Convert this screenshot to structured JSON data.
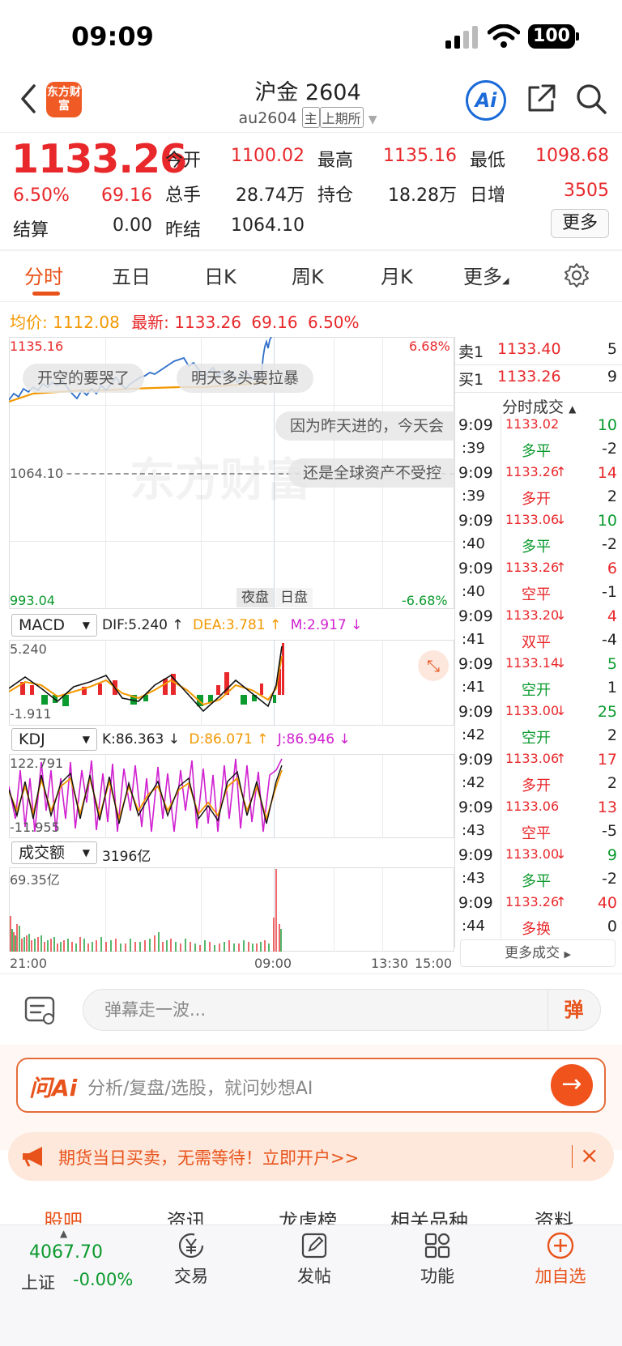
{
  "status_bar": {
    "time": "09:09",
    "battery": "100"
  },
  "header": {
    "title": "沪金 2604",
    "code": "au2604",
    "tag_main": "主",
    "tag_exchange": "上期所",
    "logo_text": "东方财富",
    "ai_label": "Ai"
  },
  "quote": {
    "price": "1133.26",
    "change_pct": "6.50%",
    "change": "69.16",
    "open_label": "今开",
    "open": "1100.02",
    "high_label": "最高",
    "high": "1135.16",
    "low_label": "最低",
    "low": "1098.68",
    "volume_label": "总手",
    "volume": "28.74万",
    "oi_label": "持仓",
    "oi": "18.28万",
    "daily_inc_label": "日增",
    "daily_inc": "3505",
    "settle_label": "结算",
    "settle": "0.00",
    "prev_settle_label": "昨结",
    "prev_settle": "1064.10",
    "more_label": "更多"
  },
  "tabs": [
    "分时",
    "五日",
    "日K",
    "周K",
    "月K",
    "更多"
  ],
  "avg_bar": {
    "avg_label": "均价:",
    "avg": "1112.08",
    "latest_label": "最新:",
    "latest": "1133.26",
    "chg": "69.16",
    "pct": "6.50%"
  },
  "main_chart": {
    "top_price": "1135.16",
    "mid_price": "1064.10",
    "bottom_price": "993.04",
    "top_pct": "6.68%",
    "bottom_pct": "-6.68%",
    "night_btn": "夜盘",
    "day_btn": "日盘",
    "watermark": "东方财富",
    "danmu": [
      "开空的要哭了",
      "明天多头要拉暴",
      "因为昨天进的，今天会",
      "还是全球资产不受控"
    ]
  },
  "macd": {
    "select": "MACD",
    "dif": "DIF:5.240 ↑",
    "dea": "DEA:3.781 ↑",
    "m": "M:2.917 ↓",
    "top": "5.240",
    "bottom": "-1.911"
  },
  "kdj": {
    "select": "KDJ",
    "k": "K:86.363 ↓",
    "d": "D:86.071 ↑",
    "j": "J:86.946 ↓",
    "top": "122.791",
    "bottom": "-11.955"
  },
  "turnover": {
    "select": "成交额",
    "value": "3196亿",
    "top": "69.35亿"
  },
  "time_axis": [
    "21:00",
    "09:00",
    "13:30",
    "15:00"
  ],
  "order_book": [
    {
      "label": "卖1",
      "price": "1133.40",
      "vol": "5"
    },
    {
      "label": "买1",
      "price": "1133.26",
      "vol": "9"
    }
  ],
  "trades_header": "分时成交",
  "trades": [
    {
      "time": "9:09",
      "price": "1133.02",
      "arrow": "",
      "vol": "10",
      "vcolor": "green",
      "sec": ":39",
      "type": "多平",
      "tcolor": "green",
      "chg": "-2"
    },
    {
      "time": "9:09",
      "price": "1133.26",
      "arrow": "↑",
      "vol": "14",
      "vcolor": "red",
      "sec": ":39",
      "type": "多开",
      "tcolor": "red",
      "chg": "2"
    },
    {
      "time": "9:09",
      "price": "1133.06",
      "arrow": "↓",
      "vol": "10",
      "vcolor": "green",
      "sec": ":40",
      "type": "多平",
      "tcolor": "green",
      "chg": "-2"
    },
    {
      "time": "9:09",
      "price": "1133.26",
      "arrow": "↑",
      "vol": "6",
      "vcolor": "red",
      "sec": ":40",
      "type": "空平",
      "tcolor": "red",
      "chg": "-1"
    },
    {
      "time": "9:09",
      "price": "1133.20",
      "arrow": "↓",
      "vol": "4",
      "vcolor": "red",
      "sec": ":41",
      "type": "双平",
      "tcolor": "red",
      "chg": "-4"
    },
    {
      "time": "9:09",
      "price": "1133.14",
      "arrow": "↓",
      "vol": "5",
      "vcolor": "green",
      "sec": ":41",
      "type": "空开",
      "tcolor": "green",
      "chg": "1"
    },
    {
      "time": "9:09",
      "price": "1133.00",
      "arrow": "↓",
      "vol": "25",
      "vcolor": "green",
      "sec": ":42",
      "type": "空开",
      "tcolor": "green",
      "chg": "2"
    },
    {
      "time": "9:09",
      "price": "1133.06",
      "arrow": "↑",
      "vol": "17",
      "vcolor": "red",
      "sec": ":42",
      "type": "多开",
      "tcolor": "red",
      "chg": "2"
    },
    {
      "time": "9:09",
      "price": "1133.06",
      "arrow": "",
      "vol": "13",
      "vcolor": "red",
      "sec": ":43",
      "type": "空平",
      "tcolor": "red",
      "chg": "-5"
    },
    {
      "time": "9:09",
      "price": "1133.00",
      "arrow": "↓",
      "vol": "9",
      "vcolor": "green",
      "sec": ":43",
      "type": "多平",
      "tcolor": "green",
      "chg": "-2"
    },
    {
      "time": "9:09",
      "price": "1133.26",
      "arrow": "↑",
      "vol": "40",
      "vcolor": "red",
      "sec": ":44",
      "type": "多换",
      "tcolor": "red",
      "chg": "0"
    }
  ],
  "more_trades": "更多成交",
  "comment": {
    "placeholder": "弹幕走一波...",
    "dan": "弹"
  },
  "ai_box": {
    "logo": "问Ai",
    "placeholder": "分析/复盘/选股，就问妙想AI"
  },
  "promo": {
    "text": "期货当日买卖，无需等待！立即开户>>"
  },
  "bottom_tabs": [
    "股吧",
    "资讯",
    "龙虎榜",
    "相关品种",
    "资料"
  ],
  "index": {
    "value": "4067.70",
    "name": "上证",
    "pct": "-0.00%"
  },
  "nav": [
    "交易",
    "发帖",
    "功能",
    "加自选"
  ],
  "colors": {
    "up": "#e8282b",
    "down": "#0b9a2d",
    "accent": "#e8531b",
    "avg": "#f39800",
    "price_line": "#2f6fc8"
  }
}
